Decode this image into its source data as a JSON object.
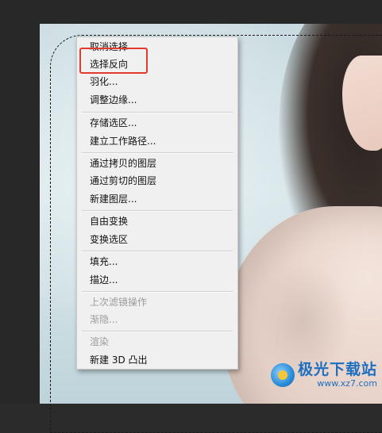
{
  "context_menu": {
    "groups": [
      [
        {
          "label": "取消选择",
          "enabled": true
        },
        {
          "label": "选择反向",
          "enabled": true,
          "highlighted": true
        },
        {
          "label": "羽化...",
          "enabled": true
        },
        {
          "label": "调整边缘...",
          "enabled": true
        }
      ],
      [
        {
          "label": "存储选区...",
          "enabled": true
        },
        {
          "label": "建立工作路径...",
          "enabled": true
        }
      ],
      [
        {
          "label": "通过拷贝的图层",
          "enabled": true
        },
        {
          "label": "通过剪切的图层",
          "enabled": true
        },
        {
          "label": "新建图层...",
          "enabled": true
        }
      ],
      [
        {
          "label": "自由变换",
          "enabled": true
        },
        {
          "label": "变换选区",
          "enabled": true
        }
      ],
      [
        {
          "label": "填充...",
          "enabled": true
        },
        {
          "label": "描边...",
          "enabled": true
        }
      ],
      [
        {
          "label": "上次滤镜操作",
          "enabled": false
        },
        {
          "label": "渐隐...",
          "enabled": false
        }
      ],
      [
        {
          "label": "渲染",
          "enabled": false
        },
        {
          "label": "新建 3D 凸出",
          "enabled": true
        }
      ]
    ]
  },
  "highlight_color": "#e23a2c",
  "watermark": {
    "title": "极光下载站",
    "url": "www.xz7.com"
  }
}
